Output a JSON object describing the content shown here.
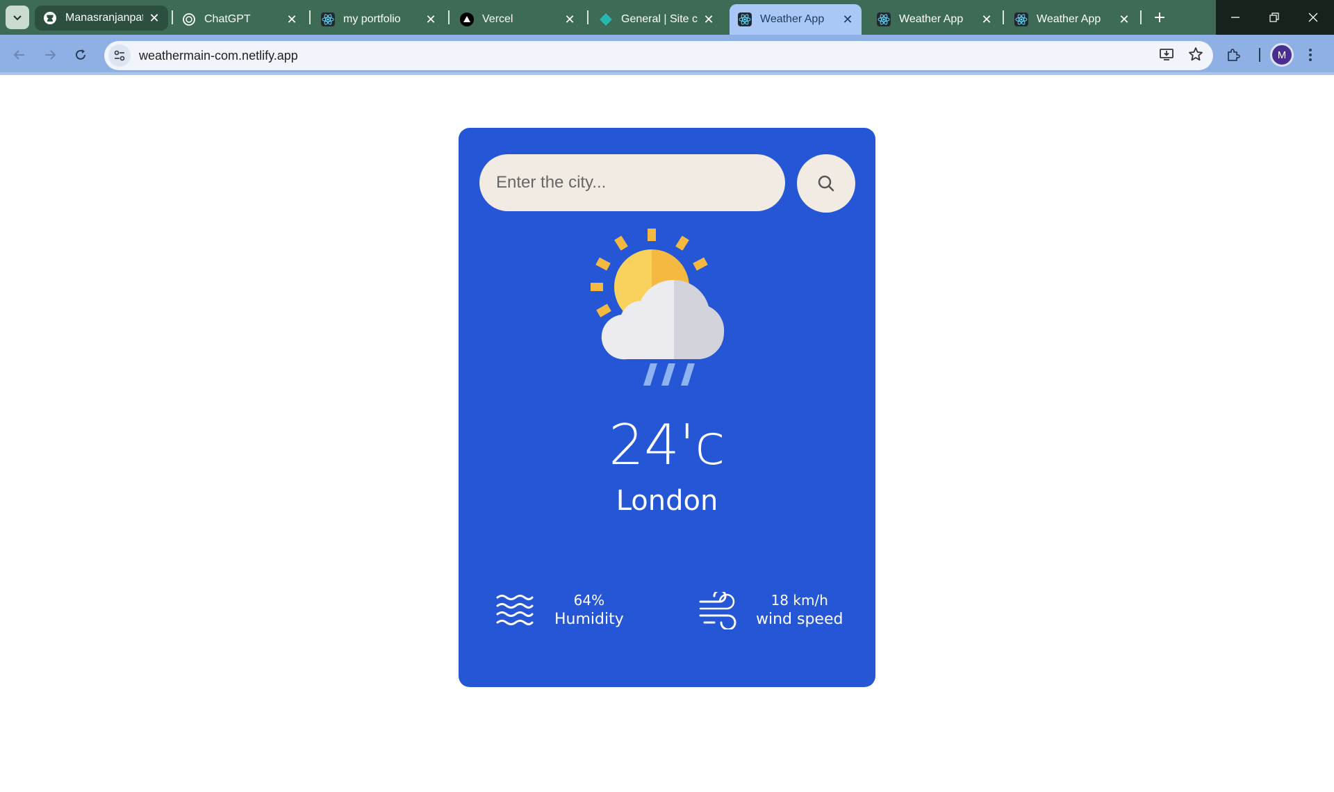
{
  "tabs": [
    {
      "title": "Manasranjanpatr",
      "icon": "github-icon"
    },
    {
      "title": "ChatGPT",
      "icon": "chatgpt-icon"
    },
    {
      "title": "my portfolio",
      "icon": "react-icon"
    },
    {
      "title": "Vercel",
      "icon": "vercel-icon"
    },
    {
      "title": "General | Site co",
      "icon": "netlify-icon"
    },
    {
      "title": "Weather App",
      "icon": "react-icon",
      "active": true
    },
    {
      "title": "Weather App",
      "icon": "react-icon"
    },
    {
      "title": "Weather App",
      "icon": "react-icon"
    }
  ],
  "address_bar": {
    "url": "weathermain-com.netlify.app"
  },
  "profile": {
    "initial": "M"
  },
  "search": {
    "placeholder": "Enter the city..."
  },
  "weather": {
    "icon": "sun-cloud-rain-icon",
    "temperature": "24'c",
    "city": "London"
  },
  "humidity": {
    "value": "64%",
    "label": "Humidity",
    "icon": "humidity-waves-icon"
  },
  "wind": {
    "value": "18 km/h",
    "label": "wind speed",
    "icon": "wind-icon"
  },
  "colors": {
    "card_bg": "#2456d6",
    "input_bg": "#f2ebe3",
    "tabstrip_bg": "#3d6b55",
    "toolbar_bg": "#8fb0e5"
  }
}
